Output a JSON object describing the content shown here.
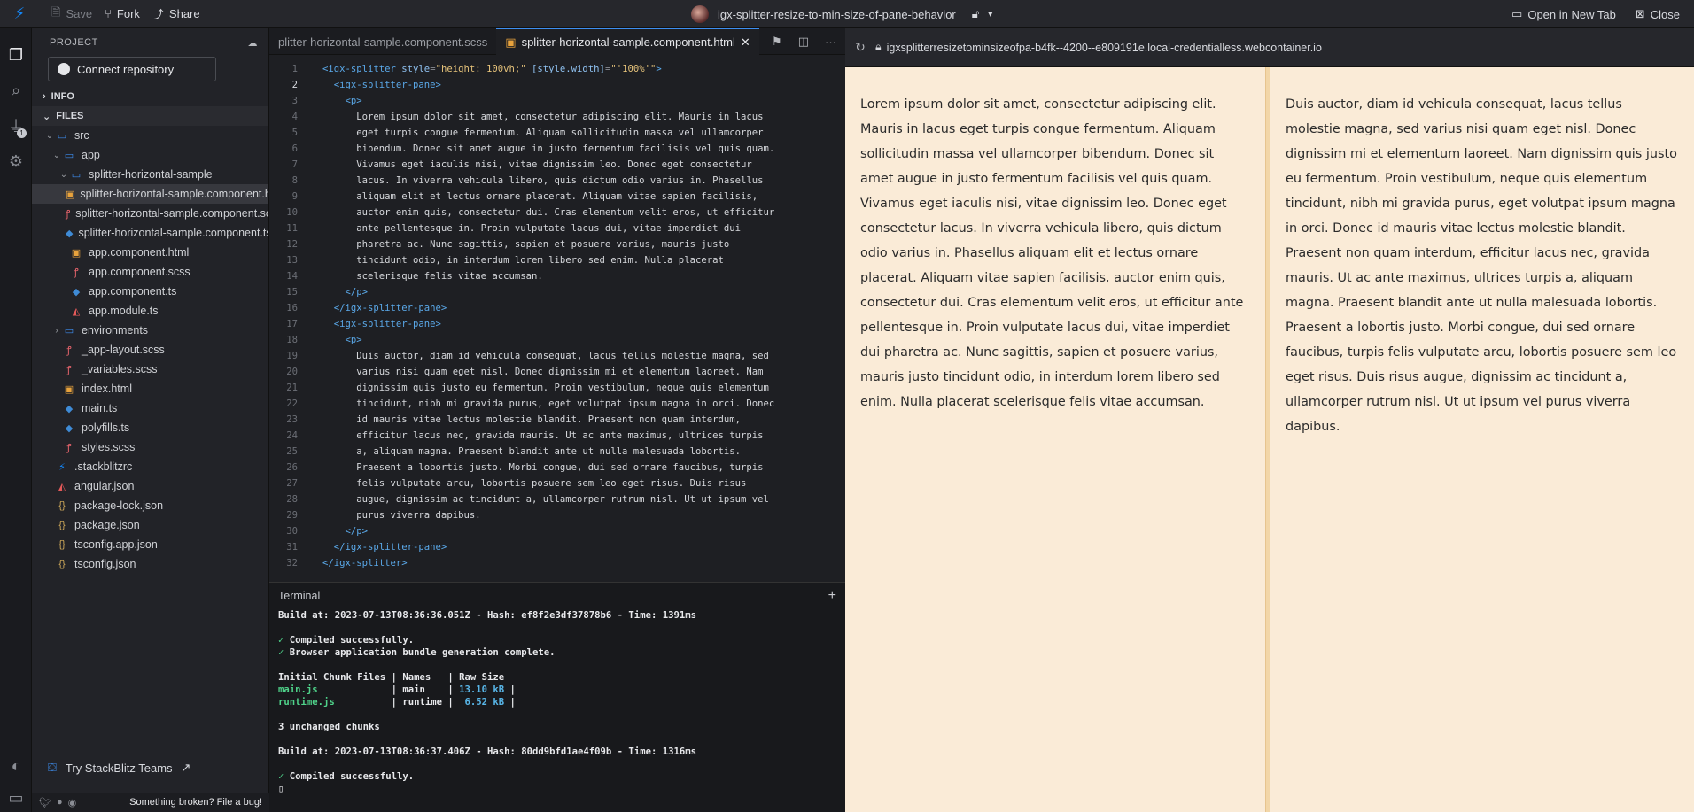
{
  "topbar": {
    "save": "Save",
    "fork": "Fork",
    "share": "Share",
    "project_title": "igx-splitter-resize-to-min-size-of-pane-behavior",
    "open_new_tab": "Open in New Tab",
    "close": "Close"
  },
  "sidebar": {
    "header": "PROJECT",
    "connect_repo": "Connect repository",
    "info": "INFO",
    "files": "FILES",
    "tree": [
      {
        "label": "src",
        "type": "folder",
        "depth": 0,
        "open": true
      },
      {
        "label": "app",
        "type": "folder",
        "depth": 1,
        "open": true
      },
      {
        "label": "splitter-horizontal-sample",
        "type": "folder",
        "depth": 2,
        "open": true
      },
      {
        "label": "splitter-horizontal-sample.component.html",
        "type": "html",
        "depth": 3,
        "selected": true
      },
      {
        "label": "splitter-horizontal-sample.component.scss",
        "type": "scss",
        "depth": 3
      },
      {
        "label": "splitter-horizontal-sample.component.ts",
        "type": "ts",
        "depth": 3
      },
      {
        "label": "app.component.html",
        "type": "html",
        "depth": 2
      },
      {
        "label": "app.component.scss",
        "type": "scss",
        "depth": 2
      },
      {
        "label": "app.component.ts",
        "type": "ts",
        "depth": 2
      },
      {
        "label": "app.module.ts",
        "type": "ang",
        "depth": 2
      },
      {
        "label": "environments",
        "type": "folder",
        "depth": 1,
        "open": false
      },
      {
        "label": "_app-layout.scss",
        "type": "scss",
        "depth": 1
      },
      {
        "label": "_variables.scss",
        "type": "scss",
        "depth": 1
      },
      {
        "label": "index.html",
        "type": "html",
        "depth": 1
      },
      {
        "label": "main.ts",
        "type": "ts",
        "depth": 1
      },
      {
        "label": "polyfills.ts",
        "type": "ts",
        "depth": 1
      },
      {
        "label": "styles.scss",
        "type": "scss",
        "depth": 1
      },
      {
        "label": ".stackblitzrc",
        "type": "zap",
        "depth": 0
      },
      {
        "label": "angular.json",
        "type": "ang",
        "depth": 0
      },
      {
        "label": "package-lock.json",
        "type": "json",
        "depth": 0
      },
      {
        "label": "package.json",
        "type": "json",
        "depth": 0
      },
      {
        "label": "tsconfig.app.json",
        "type": "json",
        "depth": 0
      },
      {
        "label": "tsconfig.json",
        "type": "json",
        "depth": 0
      }
    ],
    "try_teams": "Try StackBlitz Teams",
    "broken": "Something broken? File a bug!"
  },
  "activity_badge": "1",
  "editor": {
    "tabs": [
      {
        "label": "plitter-horizontal-sample.component.scss",
        "active": false
      },
      {
        "label": "splitter-horizontal-sample.component.html",
        "active": true
      }
    ],
    "current_line": 2
  },
  "code_lines": [
    [
      [
        "tag",
        "<igx-splitter "
      ],
      [
        "attr",
        "style"
      ],
      [
        "punc",
        "="
      ],
      [
        "str",
        "\"height: 100vh;\" "
      ],
      [
        "attr",
        "[style.width]"
      ],
      [
        "punc",
        "="
      ],
      [
        "str",
        "\"'100%'\""
      ],
      [
        "tag",
        ">"
      ]
    ],
    [
      [
        "tag",
        "  <igx-splitter-pane>"
      ]
    ],
    [
      [
        "tag",
        "    <p>"
      ]
    ],
    [
      [
        "txt",
        "      Lorem ipsum dolor sit amet, consectetur adipiscing elit. Mauris in lacus"
      ]
    ],
    [
      [
        "txt",
        "      eget turpis congue fermentum. Aliquam sollicitudin massa vel ullamcorper"
      ]
    ],
    [
      [
        "txt",
        "      bibendum. Donec sit amet augue in justo fermentum facilisis vel quis quam."
      ]
    ],
    [
      [
        "txt",
        "      Vivamus eget iaculis nisi, vitae dignissim leo. Donec eget consectetur"
      ]
    ],
    [
      [
        "txt",
        "      lacus. In viverra vehicula libero, quis dictum odio varius in. Phasellus"
      ]
    ],
    [
      [
        "txt",
        "      aliquam elit et lectus ornare placerat. Aliquam vitae sapien facilisis,"
      ]
    ],
    [
      [
        "txt",
        "      auctor enim quis, consectetur dui. Cras elementum velit eros, ut efficitur"
      ]
    ],
    [
      [
        "txt",
        "      ante pellentesque in. Proin vulputate lacus dui, vitae imperdiet dui"
      ]
    ],
    [
      [
        "txt",
        "      pharetra ac. Nunc sagittis, sapien et posuere varius, mauris justo"
      ]
    ],
    [
      [
        "txt",
        "      tincidunt odio, in interdum lorem libero sed enim. Nulla placerat"
      ]
    ],
    [
      [
        "txt",
        "      scelerisque felis vitae accumsan."
      ]
    ],
    [
      [
        "tag",
        "    </p>"
      ]
    ],
    [
      [
        "tag",
        "  </igx-splitter-pane>"
      ]
    ],
    [
      [
        "tag",
        "  <igx-splitter-pane>"
      ]
    ],
    [
      [
        "tag",
        "    <p>"
      ]
    ],
    [
      [
        "txt",
        "      Duis auctor, diam id vehicula consequat, lacus tellus molestie magna, sed"
      ]
    ],
    [
      [
        "txt",
        "      varius nisi quam eget nisl. Donec dignissim mi et elementum laoreet. Nam"
      ]
    ],
    [
      [
        "txt",
        "      dignissim quis justo eu fermentum. Proin vestibulum, neque quis elementum"
      ]
    ],
    [
      [
        "txt",
        "      tincidunt, nibh mi gravida purus, eget volutpat ipsum magna in orci. Donec"
      ]
    ],
    [
      [
        "txt",
        "      id mauris vitae lectus molestie blandit. Praesent non quam interdum,"
      ]
    ],
    [
      [
        "txt",
        "      efficitur lacus nec, gravida mauris. Ut ac ante maximus, ultrices turpis"
      ]
    ],
    [
      [
        "txt",
        "      a, aliquam magna. Praesent blandit ante ut nulla malesuada lobortis."
      ]
    ],
    [
      [
        "txt",
        "      Praesent a lobortis justo. Morbi congue, dui sed ornare faucibus, turpis"
      ]
    ],
    [
      [
        "txt",
        "      felis vulputate arcu, lobortis posuere sem leo eget risus. Duis risus"
      ]
    ],
    [
      [
        "txt",
        "      augue, dignissim ac tincidunt a, ullamcorper rutrum nisl. Ut ut ipsum vel"
      ]
    ],
    [
      [
        "txt",
        "      purus viverra dapibus."
      ]
    ],
    [
      [
        "tag",
        "    </p>"
      ]
    ],
    [
      [
        "tag",
        "  </igx-splitter-pane>"
      ]
    ],
    [
      [
        "tag",
        "</igx-splitter>"
      ]
    ]
  ],
  "terminal": {
    "title": "Terminal",
    "lines": [
      [
        [
          "",
          "Build at: 2023-07-13T08:36:36.051Z - Hash: ef8f2e3df37878b6 - Time: 1391ms"
        ]
      ],
      [
        [
          "",
          ""
        ]
      ],
      [
        [
          "green",
          "✓ "
        ],
        [
          "",
          "Compiled successfully."
        ]
      ],
      [
        [
          "green",
          "✓ "
        ],
        [
          "",
          "Browser application bundle generation complete."
        ]
      ],
      [
        [
          "",
          ""
        ]
      ],
      [
        [
          "",
          "Initial Chunk Files | Names   | Raw Size"
        ]
      ],
      [
        [
          "green",
          "main.js"
        ],
        [
          "",
          "             | main    | "
        ],
        [
          "cyan",
          "13.10 kB"
        ],
        [
          "",
          " |"
        ]
      ],
      [
        [
          "green",
          "runtime.js"
        ],
        [
          "",
          "          | runtime |  "
        ],
        [
          "cyan",
          "6.52 kB"
        ],
        [
          "",
          " |"
        ]
      ],
      [
        [
          "",
          ""
        ]
      ],
      [
        [
          "",
          "3 unchanged chunks"
        ]
      ],
      [
        [
          "",
          ""
        ]
      ],
      [
        [
          "",
          "Build at: 2023-07-13T08:36:37.406Z - Hash: 80dd9bfd1ae4f09b - Time: 1316ms"
        ]
      ],
      [
        [
          "",
          ""
        ]
      ],
      [
        [
          "green",
          "✓ "
        ],
        [
          "",
          "Compiled successfully."
        ]
      ],
      [
        [
          "",
          "▯"
        ]
      ]
    ]
  },
  "preview": {
    "url": "igxsplitterresizetominsizeofpa-b4fk--4200--e809191e.local-credentialless.webcontainer.io",
    "pane1": "Lorem ipsum dolor sit amet, consectetur adipiscing elit. Mauris in lacus eget turpis congue fermentum. Aliquam sollicitudin massa vel ullamcorper bibendum. Donec sit amet augue in justo fermentum facilisis vel quis quam. Vivamus eget iaculis nisi, vitae dignissim leo. Donec eget consectetur lacus. In viverra vehicula libero, quis dictum odio varius in. Phasellus aliquam elit et lectus ornare placerat. Aliquam vitae sapien facilisis, auctor enim quis, consectetur dui. Cras elementum velit eros, ut efficitur ante pellentesque in. Proin vulputate lacus dui, vitae imperdiet dui pharetra ac. Nunc sagittis, sapien et posuere varius, mauris justo tincidunt odio, in interdum lorem libero sed enim. Nulla placerat scelerisque felis vitae accumsan.",
    "pane2": "Duis auctor, diam id vehicula consequat, lacus tellus molestie magna, sed varius nisi quam eget nisl. Donec dignissim mi et elementum laoreet. Nam dignissim quis justo eu fermentum. Proin vestibulum, neque quis elementum tincidunt, nibh mi gravida purus, eget volutpat ipsum magna in orci. Donec id mauris vitae lectus molestie blandit. Praesent non quam interdum, efficitur lacus nec, gravida mauris. Ut ac ante maximus, ultrices turpis a, aliquam magna. Praesent blandit ante ut nulla malesuada lobortis. Praesent a lobortis justo. Morbi congue, dui sed ornare faucibus, turpis felis vulputate arcu, lobortis posuere sem leo eget risus. Duis risus augue, dignissim ac tincidunt a, ullamcorper rutrum nisl. Ut ut ipsum vel purus viverra dapibus."
  },
  "colors": {
    "accent": "#1389fd",
    "preview_bg": "#faebd7",
    "splitter_bar": "#f2d6a8"
  }
}
